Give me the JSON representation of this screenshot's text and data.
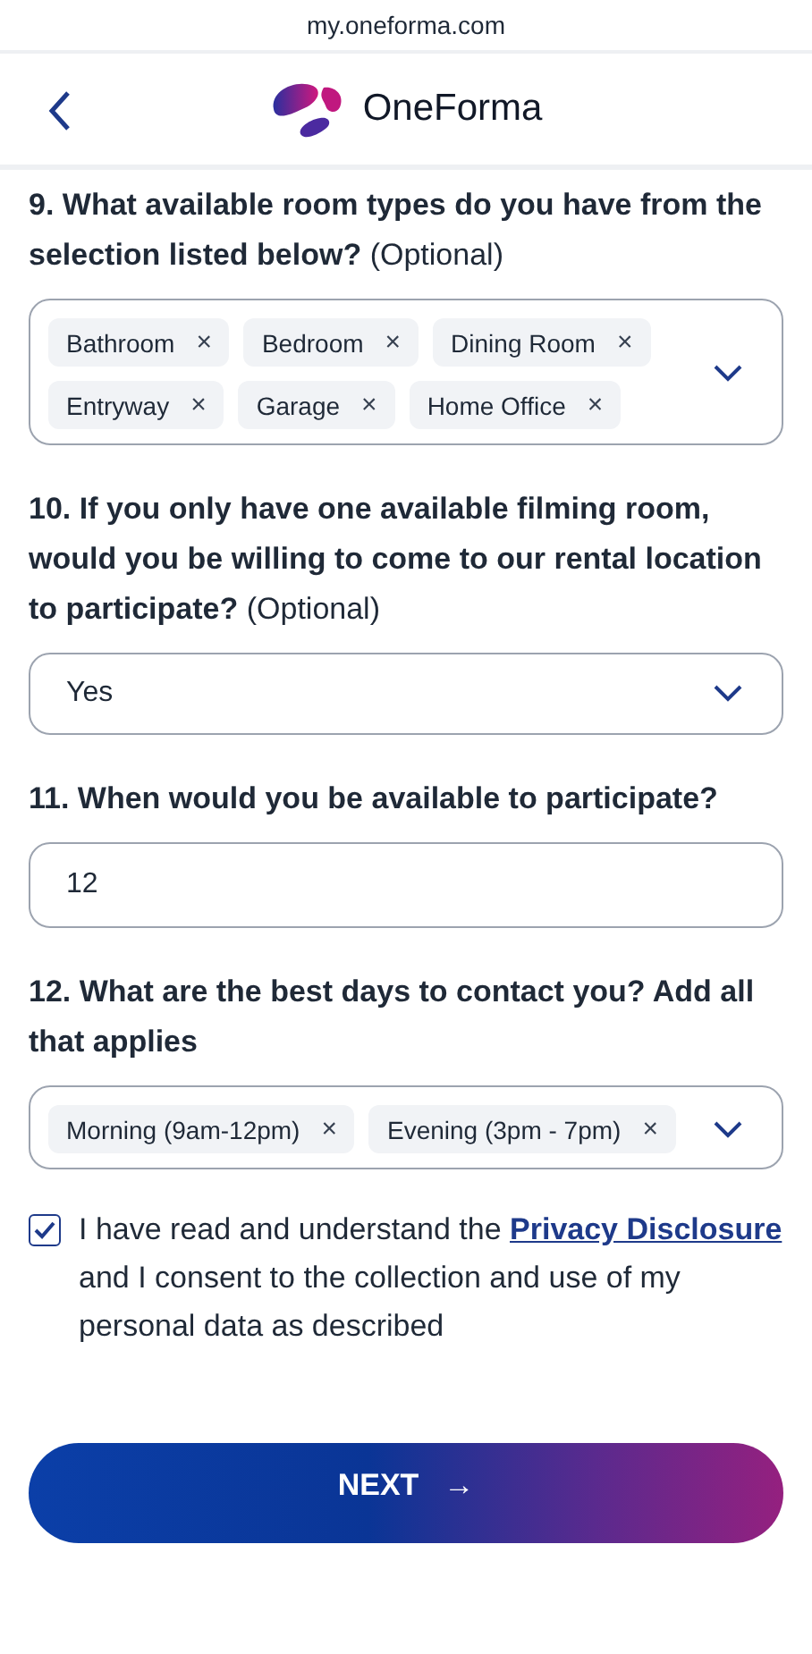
{
  "browser": {
    "url": "my.oneforma.com"
  },
  "header": {
    "brand": "OneForma"
  },
  "questions": [
    {
      "kind": "multiselect",
      "label": "9. What available room types do you have from the selection listed below?",
      "optional": "(Optional)",
      "chips": [
        "Bathroom",
        "Bedroom",
        "Dining Room",
        "Entryway",
        "Garage",
        "Home Office"
      ],
      "remove": "×"
    },
    {
      "kind": "select",
      "label": "10. If you only have one available filming room, would you be willing to come to our rental location to participate?",
      "optional": "(Optional)",
      "value": "Yes"
    },
    {
      "kind": "text",
      "label": "11. When would you be available to participate?",
      "value": "12"
    },
    {
      "kind": "multiselect",
      "label": "12. What are the best days to contact you? Add all that applies",
      "chips": [
        "Morning (9am-12pm)",
        "Evening (3pm - 7pm)"
      ],
      "remove": "×"
    }
  ],
  "consent": {
    "checked": true,
    "before": "I have read and understand the ",
    "link": "Privacy Disclosure",
    "after": " and I consent to the collection and use of my personal data as described"
  },
  "next_button": {
    "label": "NEXT",
    "arrow": "→"
  }
}
